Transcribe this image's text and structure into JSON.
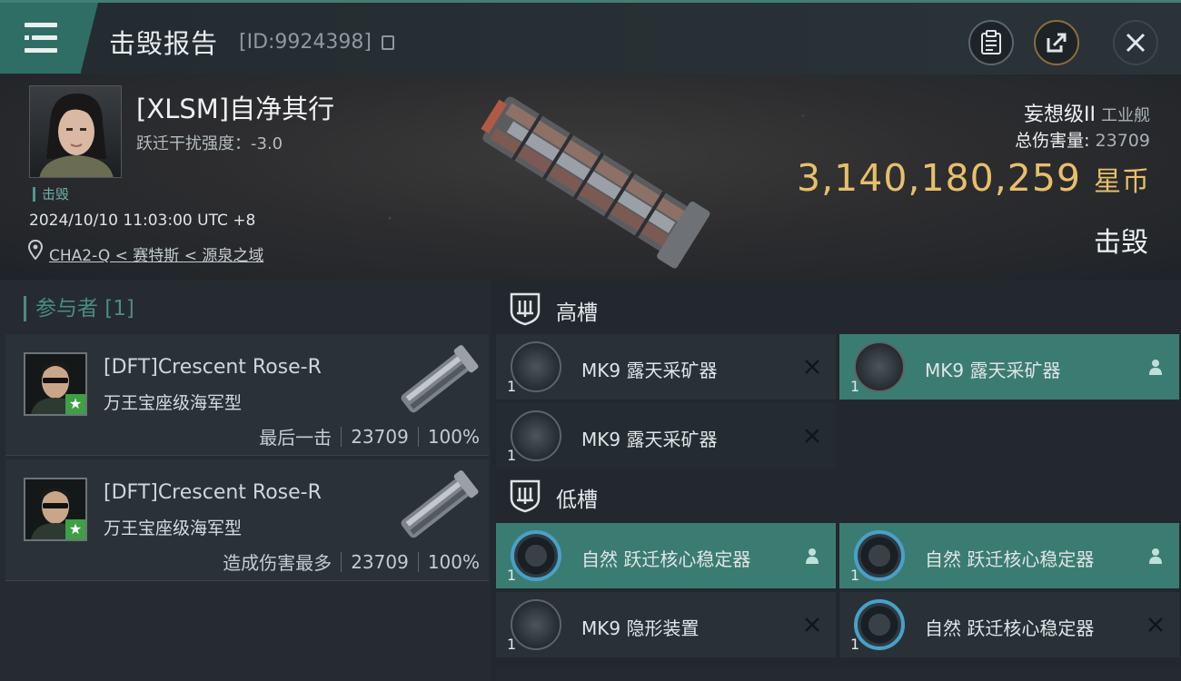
{
  "header": {
    "title": "击毁报告",
    "report_id": "[ID:9924398]"
  },
  "victim": {
    "pilot_name": "[XLSM]自净其行",
    "warp_disruption": "跃迁干扰强度：-3.0",
    "status_tag": "击毁",
    "datetime": "2024/10/10 11:03:00 UTC +8",
    "location": "CHA2-Q < 赛特斯 < 源泉之域",
    "ship_name": "妄想级II",
    "ship_type": "工业舰",
    "total_damage_label": "总伤害量:",
    "total_damage_value": "23709",
    "isk_value": "3,140,180,259",
    "isk_unit": "星币",
    "result": "击毁"
  },
  "participants": {
    "header": "参与者 [1]",
    "rows": [
      {
        "name": "[DFT]Crescent Rose-R",
        "ship": "万王宝座级海军型",
        "role": "最后一击",
        "damage": "23709",
        "percent": "100%"
      },
      {
        "name": "[DFT]Crescent Rose-R",
        "ship": "万王宝座级海军型",
        "role": "造成伤害最多",
        "damage": "23709",
        "percent": "100%"
      }
    ]
  },
  "fittings": {
    "high_slot_label": "高槽",
    "low_slot_label": "低槽",
    "high_modules": [
      {
        "name": "MK9 露天采矿器",
        "qty": "1",
        "status": "destroyed"
      },
      {
        "name": "MK9 露天采矿器",
        "qty": "1",
        "status": "dropped"
      },
      {
        "name": "MK9 露天采矿器",
        "qty": "1",
        "status": "destroyed"
      }
    ],
    "low_modules": [
      {
        "name": "自然 跃迁核心稳定器",
        "qty": "1",
        "status": "dropped"
      },
      {
        "name": "自然 跃迁核心稳定器",
        "qty": "1",
        "status": "dropped"
      },
      {
        "name": "MK9 隐形装置",
        "qty": "1",
        "status": "destroyed"
      },
      {
        "name": "自然 跃迁核心稳定器",
        "qty": "1",
        "status": "destroyed"
      }
    ]
  },
  "colors": {
    "accent_teal": "#3b7c72",
    "isk_gold": "#e8bf6a",
    "star_green": "#3e9f45"
  },
  "icons": {
    "menu": "menu-icon",
    "clipboard": "clipboard-icon",
    "share": "share-icon",
    "close": "close-icon",
    "location": "location-pin-icon",
    "destroyed": "x-icon",
    "dropped": "person-icon"
  }
}
